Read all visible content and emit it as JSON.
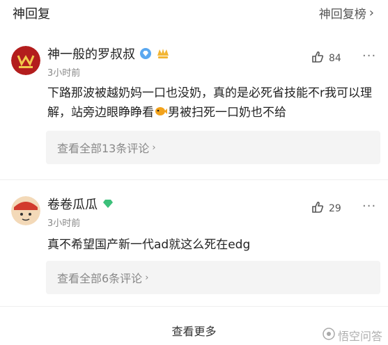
{
  "header": {
    "title": "神回复",
    "link_label": "神回复榜"
  },
  "comments": [
    {
      "user": "神一般的罗叔叔",
      "time": "3小时前",
      "likes": "84",
      "text_before": "下路那波被越奶妈一口也没奶，真的是必死省技能不r我可以理解，站旁边眼睁睁看",
      "text_after": "男被扫死一口奶也不给",
      "inline_icon": "fish-emoji-icon",
      "replies_label": "查看全部13条评论"
    },
    {
      "user": "卷卷瓜瓜",
      "time": "3小时前",
      "likes": "29",
      "text_before": "真不希望国产新一代ad就这么死在edg",
      "text_after": "",
      "replies_label": "查看全部6条评论"
    }
  ],
  "footer": {
    "see_more": "查看更多",
    "watermark": "悟空问答"
  },
  "icons": {
    "more": "more-dots-icon",
    "like": "like-icon",
    "badge1": "diamond-badge-icon",
    "badge2": "gold-badge-icon"
  },
  "colors": {
    "accent_blue": "#5aa8f0",
    "badge_gold": "#f2b534",
    "badge_green": "#3cc07a",
    "avatar1": "#b31d1d"
  }
}
